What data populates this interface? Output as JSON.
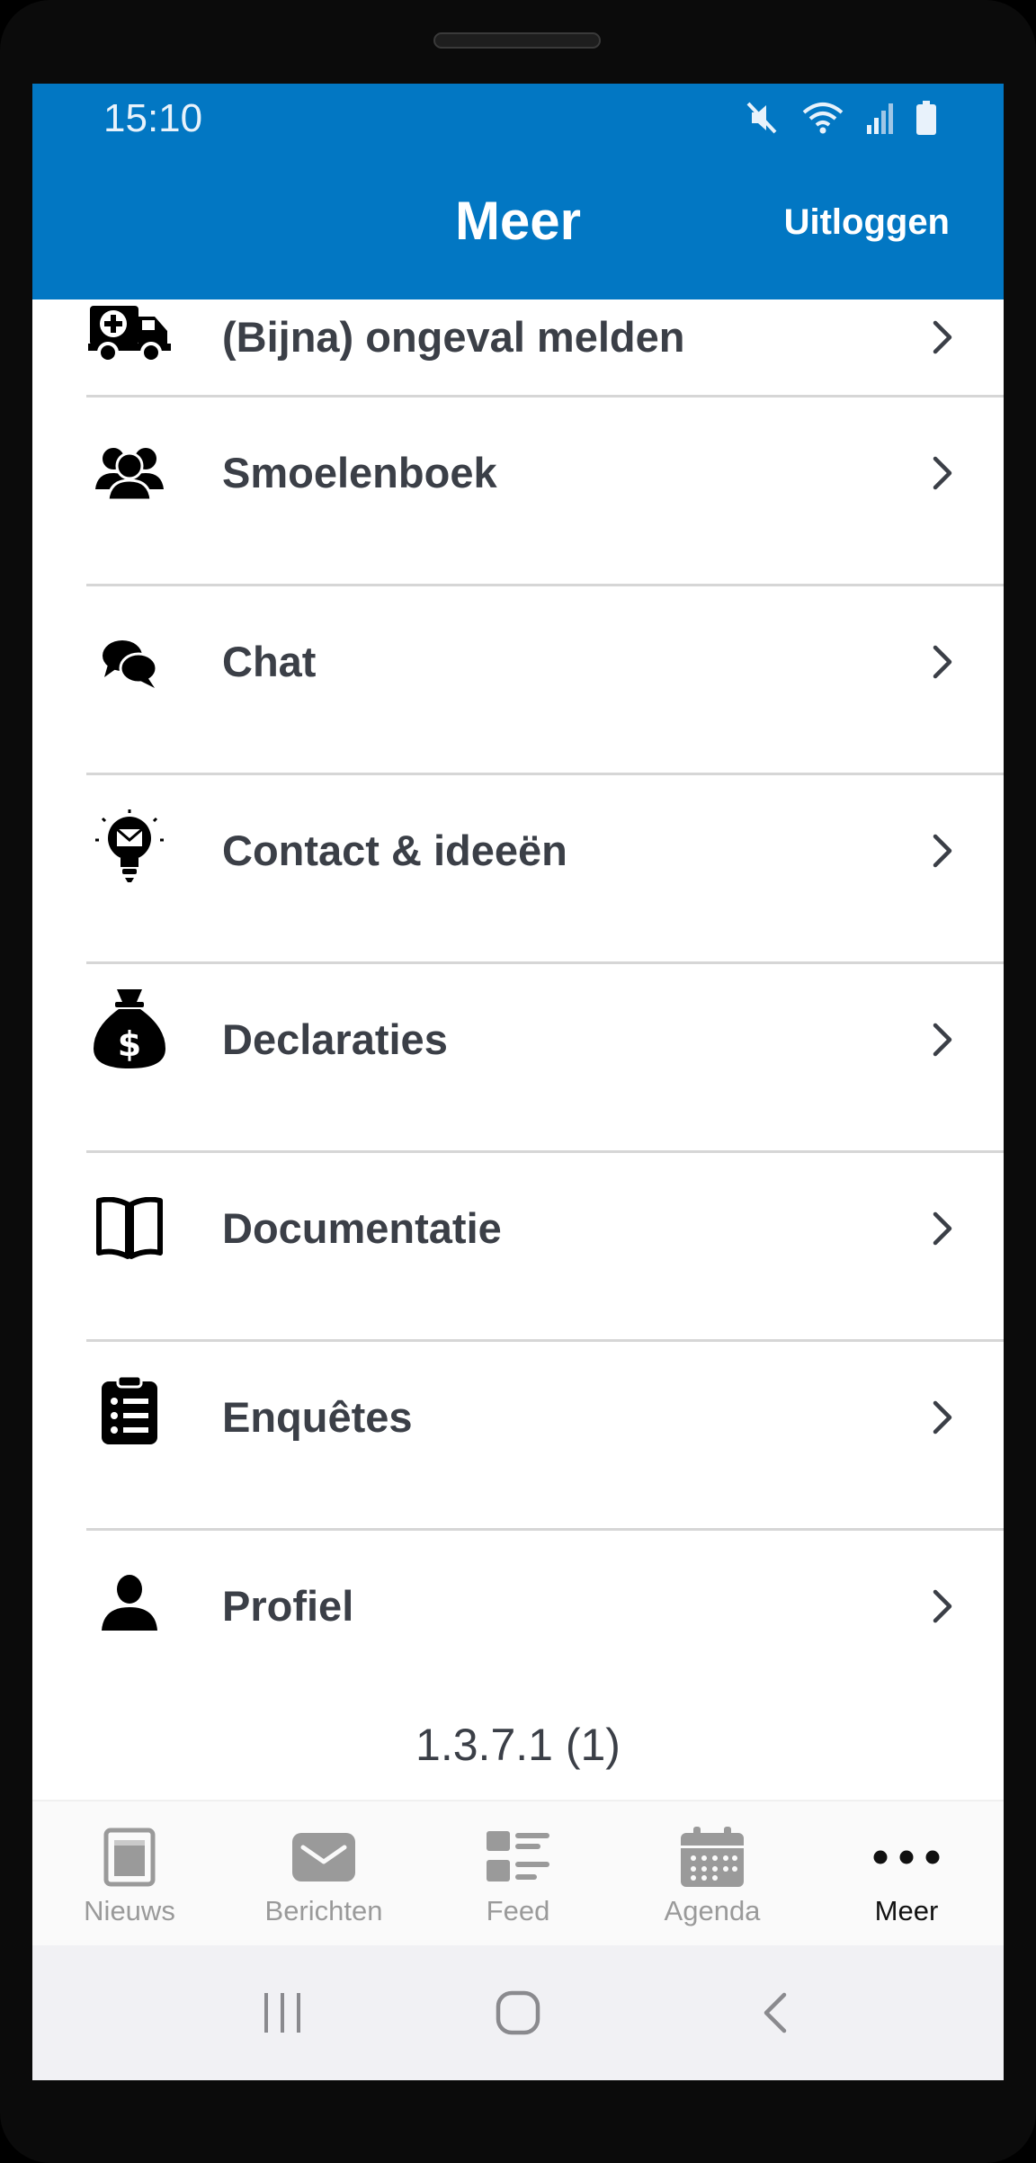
{
  "status_bar": {
    "time": "15:10",
    "icons": [
      "mute-icon",
      "wifi-icon",
      "signal-icon",
      "battery-icon"
    ]
  },
  "header": {
    "title": "Meer",
    "logout_label": "Uitloggen",
    "background": "#0277c3"
  },
  "menu": {
    "items": [
      {
        "label": "(Bijna) ongeval melden",
        "icon": "ambulance-icon"
      },
      {
        "label": "Smoelenboek",
        "icon": "users-icon"
      },
      {
        "label": "Chat",
        "icon": "chat-bubbles-icon"
      },
      {
        "label": "Contact & ideeën",
        "icon": "lightbulb-mail-icon"
      },
      {
        "label": "Declaraties",
        "icon": "money-bag-icon"
      },
      {
        "label": "Documentatie",
        "icon": "book-icon"
      },
      {
        "label": "Enquêtes",
        "icon": "clipboard-list-icon"
      },
      {
        "label": "Profiel",
        "icon": "user-icon"
      }
    ]
  },
  "version": "1.3.7.1 (1)",
  "tabbar": {
    "tabs": [
      {
        "label": "Nieuws",
        "icon": "newspaper-icon",
        "active": false
      },
      {
        "label": "Berichten",
        "icon": "envelope-icon",
        "active": false
      },
      {
        "label": "Feed",
        "icon": "feed-list-icon",
        "active": false
      },
      {
        "label": "Agenda",
        "icon": "calendar-icon",
        "active": false
      },
      {
        "label": "Meer",
        "icon": "more-dots-icon",
        "active": true
      }
    ]
  },
  "navbar": {
    "buttons": [
      "recent-apps-icon",
      "home-icon",
      "back-icon"
    ]
  }
}
